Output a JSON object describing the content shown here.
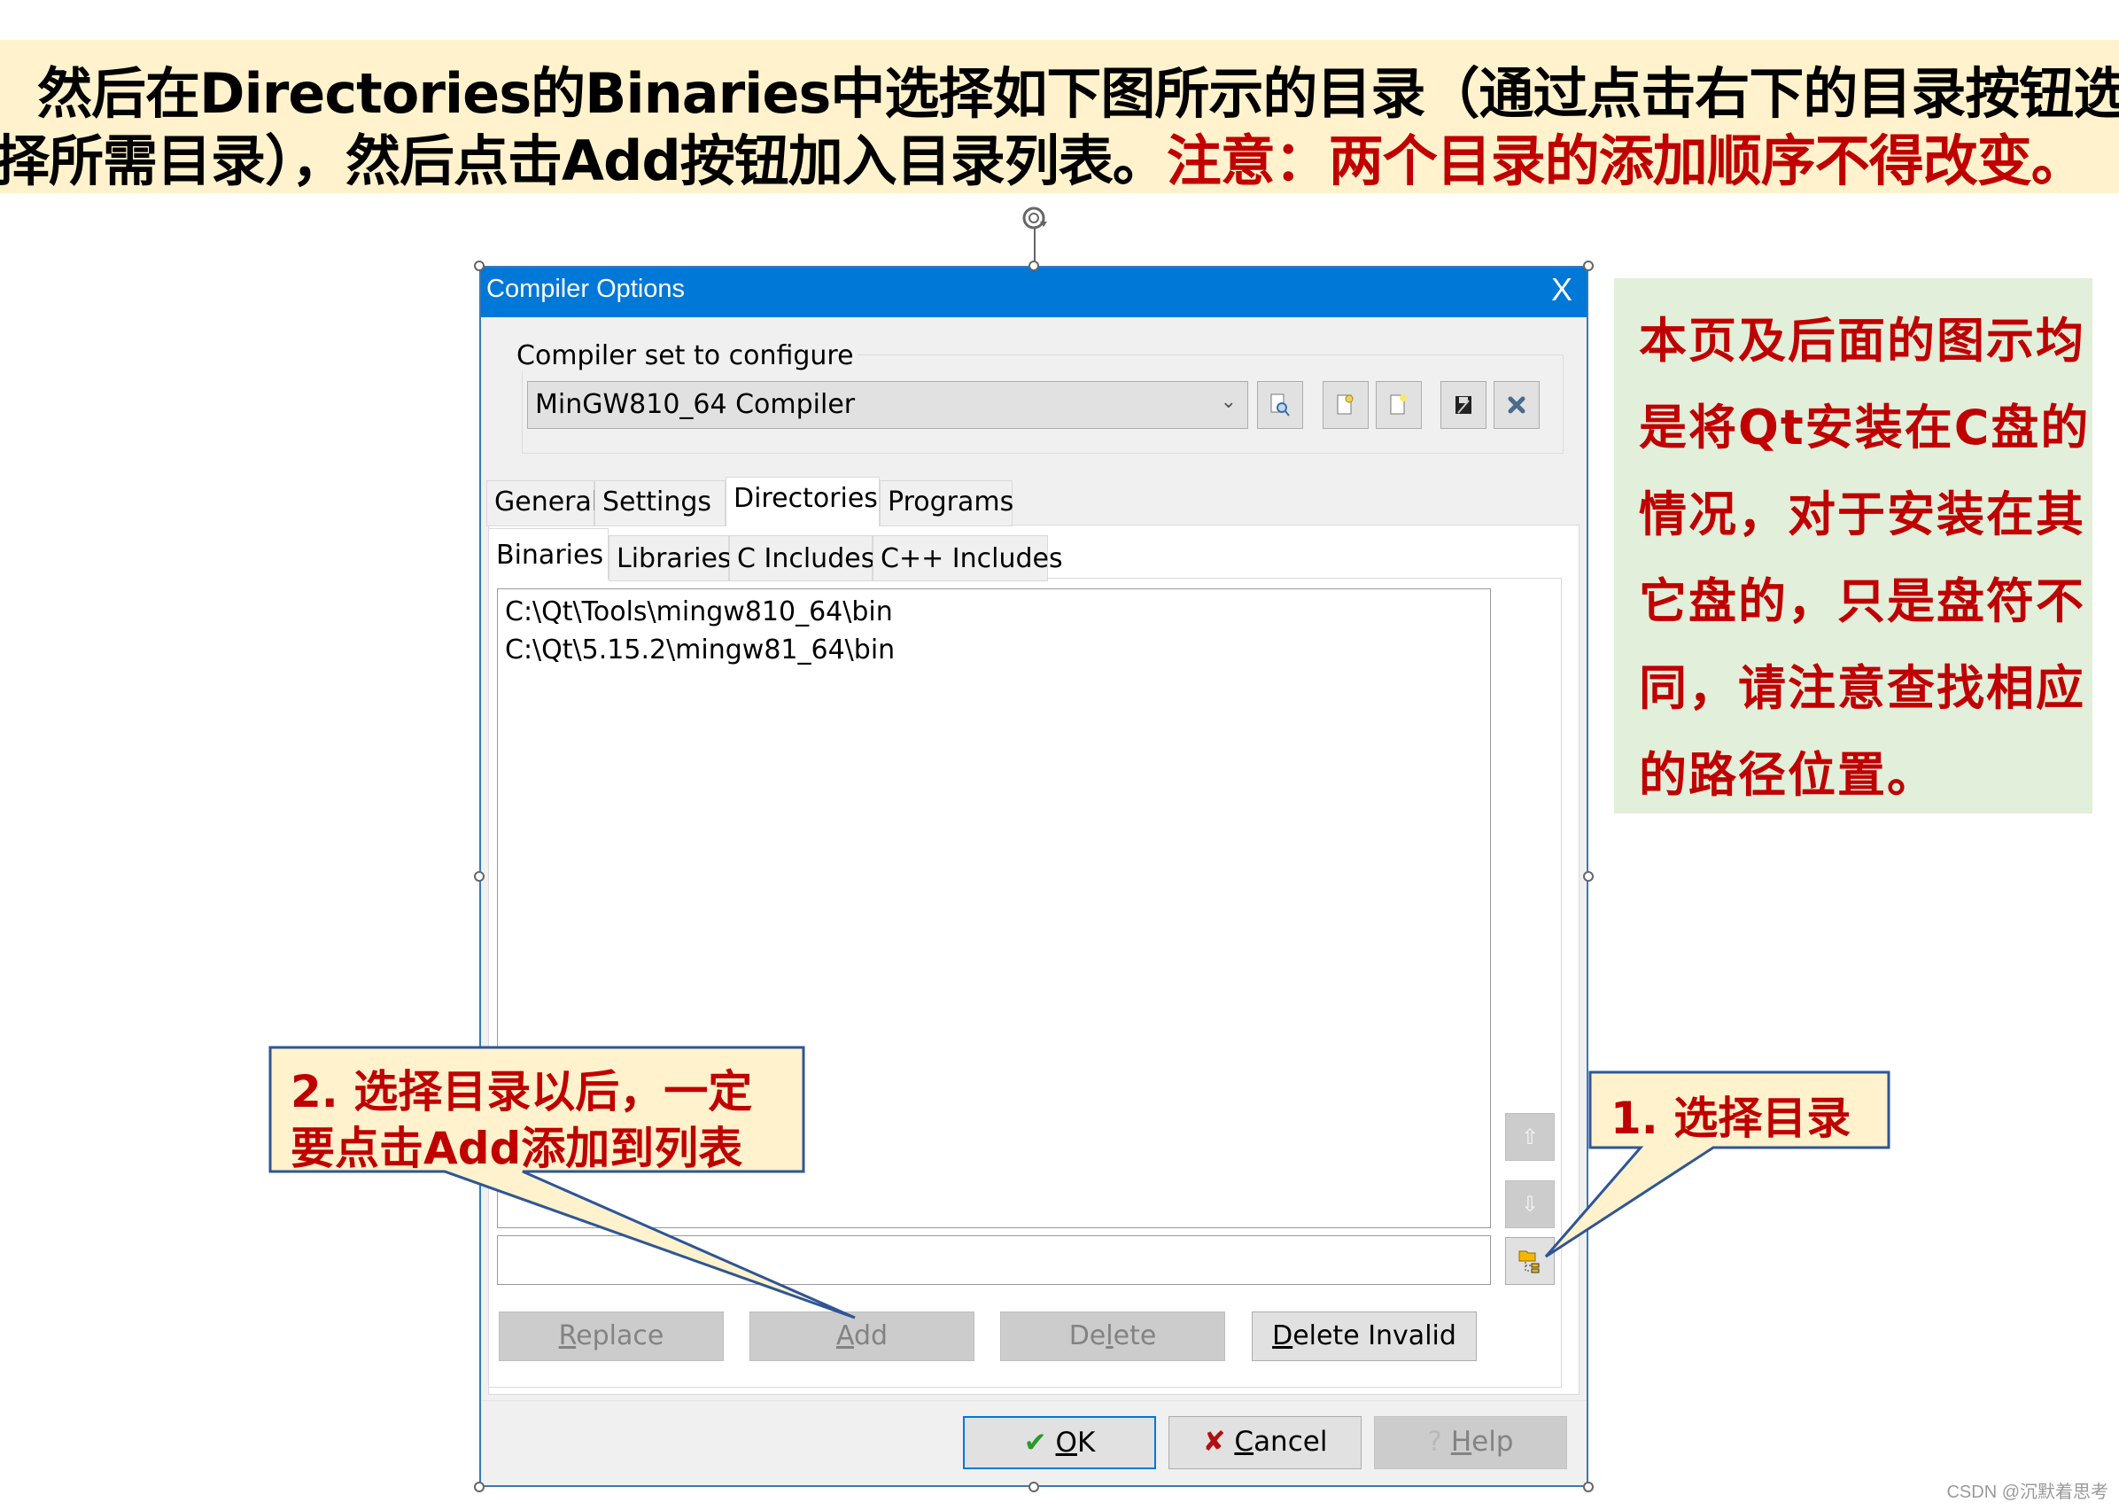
{
  "banner": {
    "line1": "然后在Directories的Binaries中选择如下图所示的目录（通过点击右下的目录按钮选",
    "line2_black": "择所需目录），然后点击Add按钮加入目录列表。",
    "line2_red": "注意：两个目录的添加顺序不得改变。",
    "bg_color": "#FFF2CC",
    "highlight_color": "#C00000"
  },
  "dialog": {
    "title": "Compiler Options",
    "close_label": "X",
    "titlebar_color": "#0078D7",
    "compiler_group": {
      "label": "Compiler set to configure",
      "selected": "MinGW810_64 Compiler",
      "toolbar_icons": [
        "find-compiler-icon",
        "add-compiler-icon",
        "new-compiler-icon",
        "save-icon",
        "delete-compiler-icon"
      ]
    },
    "tabs": [
      {
        "label": "General",
        "active": false
      },
      {
        "label": "Settings",
        "active": false
      },
      {
        "label": "Directories",
        "active": true
      },
      {
        "label": "Programs",
        "active": false
      }
    ],
    "subtabs": [
      {
        "label": "Binaries",
        "active": true
      },
      {
        "label": "Libraries",
        "active": false
      },
      {
        "label": "C Includes",
        "active": false
      },
      {
        "label": "C++ Includes",
        "active": false
      }
    ],
    "directories": [
      "C:\\Qt\\Tools\\mingw810_64\\bin",
      "C:\\Qt\\5.15.2\\mingw81_64\\bin"
    ],
    "dir_input_value": "",
    "side_buttons": {
      "up": "⇧",
      "down": "⇩"
    },
    "actions": {
      "replace": {
        "pre": "",
        "key": "R",
        "post": "eplace",
        "enabled": false
      },
      "add": {
        "pre": "",
        "key": "A",
        "post": "dd",
        "enabled": false
      },
      "delete": {
        "pre": "De",
        "key": "l",
        "post": "ete",
        "enabled": false
      },
      "delete_invalid": {
        "pre": "",
        "key": "D",
        "post": "elete Invalid",
        "enabled": true
      }
    },
    "footer": {
      "ok": {
        "icon": "✔",
        "key": "O",
        "post": "K"
      },
      "cancel": {
        "icon": "✘",
        "key": "C",
        "post": "ancel"
      },
      "help": {
        "icon": "?",
        "key": "H",
        "post": "elp",
        "enabled": false
      }
    }
  },
  "note": {
    "lines": [
      "本页及后面的图示均",
      "是将Qt安装在C盘的",
      "情况，对于安装在其",
      "它盘的，只是盘符不",
      "同，请注意查找相应",
      "的路径位置。"
    ],
    "bg_color": "#E2EFDA"
  },
  "callouts": {
    "step1": "1. 选择目录",
    "step2_line1": "2. 选择目录以后，一定",
    "step2_line2": "要点击Add添加到列表",
    "fill": "#FFF2CC",
    "border": "#2F5597"
  },
  "watermark": "CSDN @沉默着思考"
}
